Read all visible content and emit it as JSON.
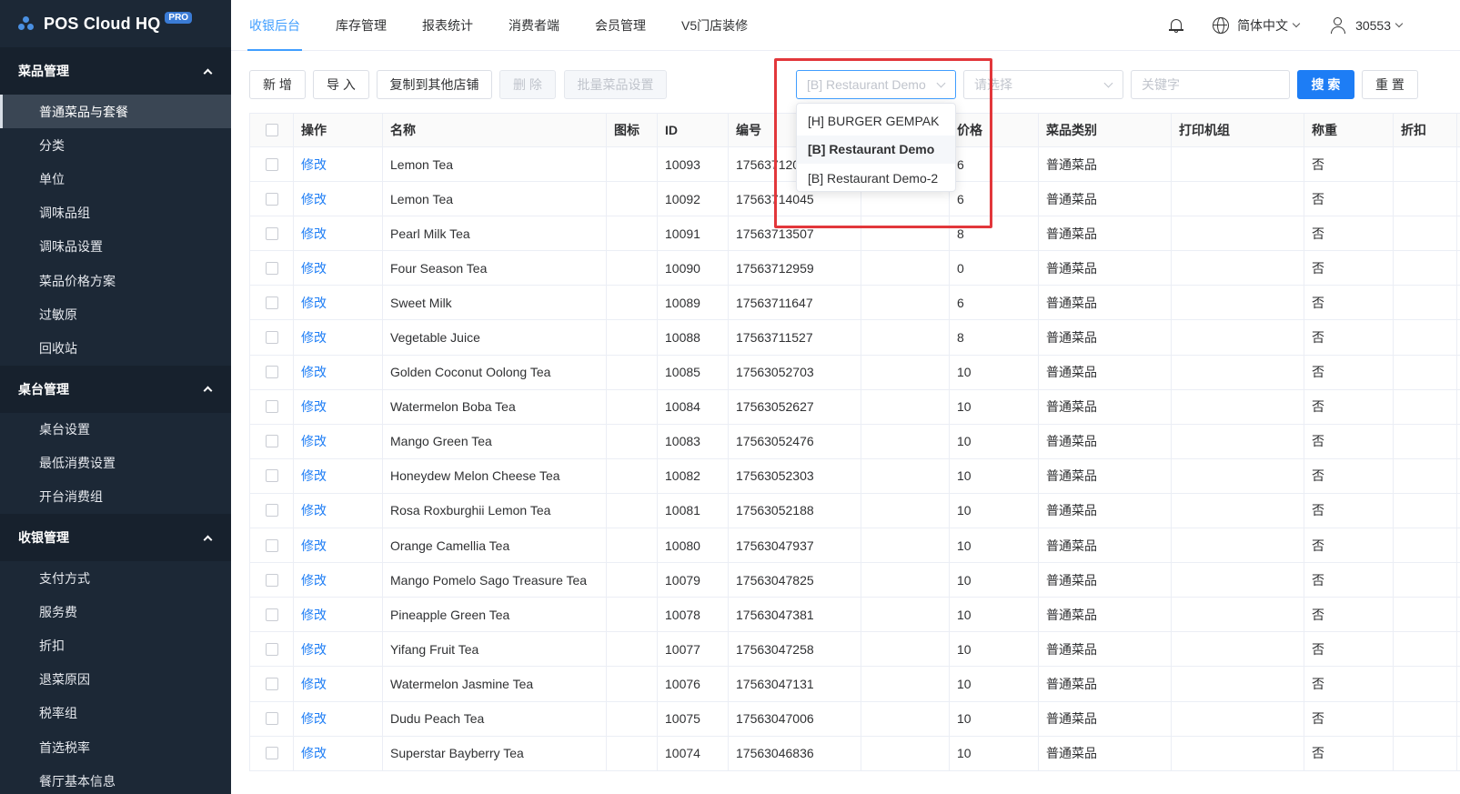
{
  "brand": {
    "title": "POS Cloud HQ",
    "badge": "PRO"
  },
  "sidebar": {
    "groups": [
      {
        "title": "菜品管理",
        "items": [
          "普通菜品与套餐",
          "分类",
          "单位",
          "调味品组",
          "调味品设置",
          "菜品价格方案",
          "过敏原",
          "回收站"
        ]
      },
      {
        "title": "桌台管理",
        "items": [
          "桌台设置",
          "最低消费设置",
          "开台消费组"
        ]
      },
      {
        "title": "收银管理",
        "items": [
          "支付方式",
          "服务费",
          "折扣",
          "退菜原因",
          "税率组",
          "首选税率",
          "餐厅基本信息"
        ]
      }
    ],
    "active_item": "普通菜品与套餐"
  },
  "topnav": {
    "tabs": [
      "收银后台",
      "库存管理",
      "报表统计",
      "消费者端",
      "会员管理",
      "V5门店装修"
    ],
    "active_tab": "收银后台",
    "language": "简体中文",
    "user": "30553"
  },
  "toolbar": {
    "add": "新 增",
    "import": "导 入",
    "copy": "复制到其他店铺",
    "delete": "删 除",
    "batch": "批量菜品设置",
    "store_select": "[B] Restaurant Demo",
    "category_placeholder": "请选择",
    "keyword_placeholder": "关键字",
    "search": "搜 索",
    "reset": "重 置"
  },
  "dropdown": {
    "options": [
      "[H] BURGER GEMPAK",
      "[B] Restaurant Demo",
      "[B] Restaurant Demo-2"
    ],
    "selected": "[B] Restaurant Demo"
  },
  "table": {
    "headers": [
      "",
      "操作",
      "名称",
      "图标",
      "ID",
      "编号",
      "",
      "价格",
      "菜品类别",
      "打印机组",
      "称重",
      "折扣"
    ],
    "edit_label": "修改",
    "rows": [
      {
        "name": "Lemon Tea",
        "id": "10093",
        "code": "17563712003",
        "price": "6",
        "category": "普通菜品",
        "weigh": "否"
      },
      {
        "name": "Lemon Tea",
        "id": "10092",
        "code": "17563714045",
        "price": "6",
        "category": "普通菜品",
        "weigh": "否"
      },
      {
        "name": "Pearl Milk Tea",
        "id": "10091",
        "code": "17563713507",
        "price": "8",
        "category": "普通菜品",
        "weigh": "否"
      },
      {
        "name": "Four Season Tea",
        "id": "10090",
        "code": "17563712959",
        "price": "0",
        "category": "普通菜品",
        "weigh": "否"
      },
      {
        "name": "Sweet Milk",
        "id": "10089",
        "code": "17563711647",
        "price": "6",
        "category": "普通菜品",
        "weigh": "否"
      },
      {
        "name": "Vegetable Juice",
        "id": "10088",
        "code": "17563711527",
        "price": "8",
        "category": "普通菜品",
        "weigh": "否"
      },
      {
        "name": "Golden Coconut Oolong Tea",
        "id": "10085",
        "code": "17563052703",
        "price": "10",
        "category": "普通菜品",
        "weigh": "否"
      },
      {
        "name": "Watermelon Boba Tea",
        "id": "10084",
        "code": "17563052627",
        "price": "10",
        "category": "普通菜品",
        "weigh": "否"
      },
      {
        "name": "Mango Green Tea",
        "id": "10083",
        "code": "17563052476",
        "price": "10",
        "category": "普通菜品",
        "weigh": "否"
      },
      {
        "name": "Honeydew Melon Cheese Tea",
        "id": "10082",
        "code": "17563052303",
        "price": "10",
        "category": "普通菜品",
        "weigh": "否"
      },
      {
        "name": "Rosa Roxburghii Lemon Tea",
        "id": "10081",
        "code": "17563052188",
        "price": "10",
        "category": "普通菜品",
        "weigh": "否"
      },
      {
        "name": "Orange Camellia Tea",
        "id": "10080",
        "code": "17563047937",
        "price": "10",
        "category": "普通菜品",
        "weigh": "否"
      },
      {
        "name": "Mango Pomelo Sago Treasure Tea",
        "id": "10079",
        "code": "17563047825",
        "price": "10",
        "category": "普通菜品",
        "weigh": "否"
      },
      {
        "name": "Pineapple Green Tea",
        "id": "10078",
        "code": "17563047381",
        "price": "10",
        "category": "普通菜品",
        "weigh": "否"
      },
      {
        "name": "Yifang Fruit Tea",
        "id": "10077",
        "code": "17563047258",
        "price": "10",
        "category": "普通菜品",
        "weigh": "否"
      },
      {
        "name": "Watermelon Jasmine Tea",
        "id": "10076",
        "code": "17563047131",
        "price": "10",
        "category": "普通菜品",
        "weigh": "否"
      },
      {
        "name": "Dudu Peach Tea",
        "id": "10075",
        "code": "17563047006",
        "price": "10",
        "category": "普通菜品",
        "weigh": "否"
      },
      {
        "name": "Superstar Bayberry Tea",
        "id": "10074",
        "code": "17563046836",
        "price": "10",
        "category": "普通菜品",
        "weigh": "否"
      }
    ]
  },
  "colors": {
    "sidebar_bg": "#1c2836",
    "accent": "#1d7df5",
    "highlight_box": "#e2373b"
  }
}
